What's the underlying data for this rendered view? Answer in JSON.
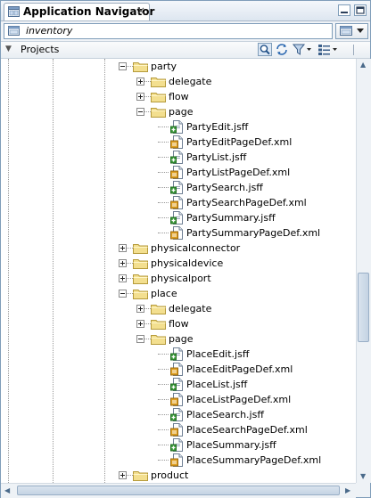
{
  "panel": {
    "title": "Application Navigator",
    "close": "×"
  },
  "combo": {
    "value": "inventory"
  },
  "projects": {
    "label": "Projects"
  },
  "tree": [
    {
      "label": "party",
      "type": "folder",
      "depth": 0,
      "expanded": true
    },
    {
      "label": "delegate",
      "type": "folder",
      "depth": 1,
      "expanded": false
    },
    {
      "label": "flow",
      "type": "folder",
      "depth": 1,
      "expanded": false
    },
    {
      "label": "page",
      "type": "folder",
      "depth": 1,
      "expanded": true
    },
    {
      "label": "PartyEdit.jsff",
      "type": "jsff",
      "depth": 2
    },
    {
      "label": "PartyEditPageDef.xml",
      "type": "xml",
      "depth": 2
    },
    {
      "label": "PartyList.jsff",
      "type": "jsff",
      "depth": 2
    },
    {
      "label": "PartyListPageDef.xml",
      "type": "xml",
      "depth": 2
    },
    {
      "label": "PartySearch.jsff",
      "type": "jsff",
      "depth": 2
    },
    {
      "label": "PartySearchPageDef.xml",
      "type": "xml",
      "depth": 2
    },
    {
      "label": "PartySummary.jsff",
      "type": "jsff",
      "depth": 2
    },
    {
      "label": "PartySummaryPageDef.xml",
      "type": "xml",
      "depth": 2
    },
    {
      "label": "physicalconnector",
      "type": "folder",
      "depth": 0,
      "expanded": false
    },
    {
      "label": "physicaldevice",
      "type": "folder",
      "depth": 0,
      "expanded": false
    },
    {
      "label": "physicalport",
      "type": "folder",
      "depth": 0,
      "expanded": false
    },
    {
      "label": "place",
      "type": "folder",
      "depth": 0,
      "expanded": true
    },
    {
      "label": "delegate",
      "type": "folder",
      "depth": 1,
      "expanded": false
    },
    {
      "label": "flow",
      "type": "folder",
      "depth": 1,
      "expanded": false
    },
    {
      "label": "page",
      "type": "folder",
      "depth": 1,
      "expanded": true
    },
    {
      "label": "PlaceEdit.jsff",
      "type": "jsff",
      "depth": 2
    },
    {
      "label": "PlaceEditPageDef.xml",
      "type": "xml",
      "depth": 2
    },
    {
      "label": "PlaceList.jsff",
      "type": "jsff",
      "depth": 2
    },
    {
      "label": "PlaceListPageDef.xml",
      "type": "xml",
      "depth": 2
    },
    {
      "label": "PlaceSearch.jsff",
      "type": "jsff",
      "depth": 2
    },
    {
      "label": "PlaceSearchPageDef.xml",
      "type": "xml",
      "depth": 2
    },
    {
      "label": "PlaceSummary.jsff",
      "type": "jsff",
      "depth": 2
    },
    {
      "label": "PlaceSummaryPageDef.xml",
      "type": "xml",
      "depth": 2
    },
    {
      "label": "product",
      "type": "folder",
      "depth": 0,
      "expanded": false
    }
  ],
  "icons": {
    "folder": "folder-icon",
    "jsff": "jsff-file-icon",
    "xml": "xml-file-icon",
    "search": "search-icon",
    "sync": "sync-icon",
    "filter": "filter-icon",
    "options": "options-icon"
  },
  "colors": {
    "folderFill": "#f3df8f",
    "folderStroke": "#b59a3a",
    "jsffGreen": "#3a9a3a",
    "xmlOrange": "#e0a020",
    "panelBorder": "#7f9db9"
  }
}
